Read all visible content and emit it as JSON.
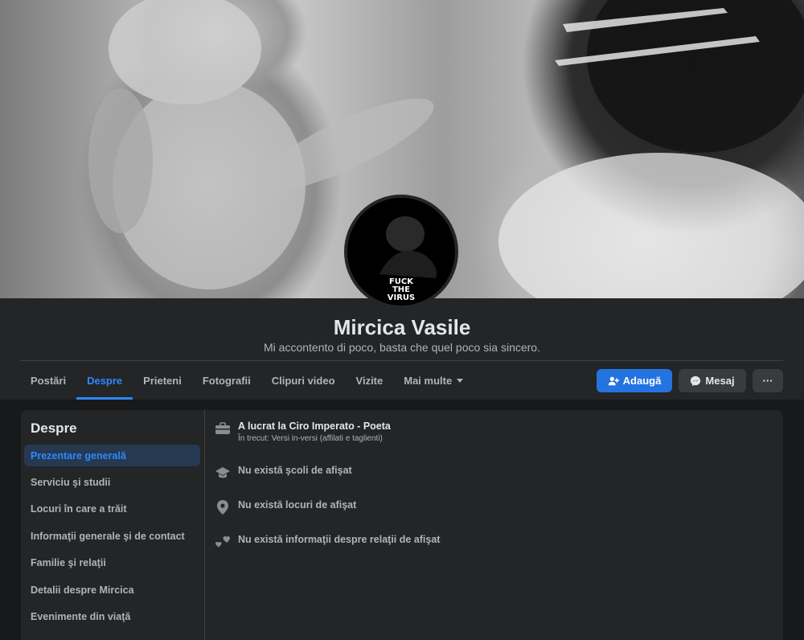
{
  "profile": {
    "name": "Mircica Vasile",
    "bio": "Mi accontento di poco, basta che quel poco sia sincero.",
    "avatar_text": [
      "FUCK",
      "THE",
      "VIRUS"
    ]
  },
  "tabs": [
    {
      "label": "Postări",
      "active": false
    },
    {
      "label": "Despre",
      "active": true
    },
    {
      "label": "Prieteni",
      "active": false
    },
    {
      "label": "Fotografii",
      "active": false
    },
    {
      "label": "Clipuri video",
      "active": false
    },
    {
      "label": "Vizite",
      "active": false
    },
    {
      "label": "Mai multe",
      "active": false,
      "icon": "chevron-down-icon"
    }
  ],
  "actions": {
    "add_label": "Adaugă",
    "add_icon": "person-add-icon",
    "message_label": "Mesaj",
    "message_icon": "messenger-icon",
    "more_label": "···"
  },
  "about": {
    "title": "Despre",
    "nav": [
      {
        "label": "Prezentare generală",
        "active": true
      },
      {
        "label": "Serviciu şi studii",
        "active": false
      },
      {
        "label": "Locuri în care a trăit",
        "active": false
      },
      {
        "label": "Informaţii generale şi de contact",
        "active": false
      },
      {
        "label": "Familie şi relaţii",
        "active": false
      },
      {
        "label": "Detalii despre Mircica",
        "active": false
      },
      {
        "label": "Evenimente din viaţă",
        "active": false
      }
    ],
    "work": {
      "title": "A lucrat la Ciro Imperato - Poeta",
      "subtitle": "În trecut: Versi in-versi (affilati e taglienti)",
      "icon": "briefcase-icon"
    },
    "school": {
      "text": "Nu există şcoli de afişat",
      "icon": "graduation-cap-icon"
    },
    "places": {
      "text": "Nu există locuri de afişat",
      "icon": "location-pin-icon"
    },
    "relationship": {
      "text": "Nu există informaţii despre relaţii de afişat",
      "icon": "hearts-icon"
    }
  },
  "colors": {
    "accent": "#2d88ff",
    "background": "#18191a",
    "card": "#242526"
  }
}
